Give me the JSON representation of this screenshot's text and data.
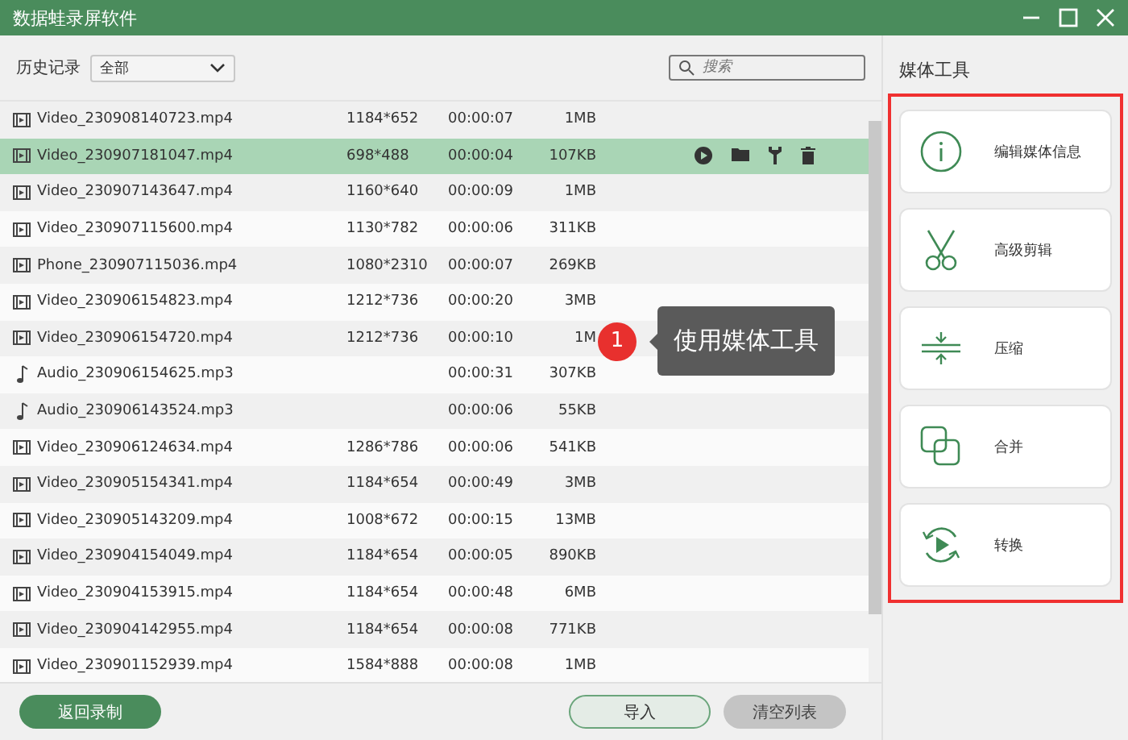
{
  "window": {
    "title": "数据蛙录屏软件"
  },
  "toolbar": {
    "history_label": "历史记录",
    "filter": "全部",
    "search": {
      "placeholder": "搜索"
    }
  },
  "files": [
    {
      "kind": "video",
      "name": "Video_230908140723.mp4",
      "resolution": "1184*652",
      "duration": "00:00:07",
      "size": "1MB",
      "selected": false
    },
    {
      "kind": "video",
      "name": "Video_230907181047.mp4",
      "resolution": "698*488",
      "duration": "00:00:04",
      "size": "107KB",
      "selected": true
    },
    {
      "kind": "video",
      "name": "Video_230907143647.mp4",
      "resolution": "1160*640",
      "duration": "00:00:09",
      "size": "1MB",
      "selected": false
    },
    {
      "kind": "video",
      "name": "Video_230907115600.mp4",
      "resolution": "1130*782",
      "duration": "00:00:06",
      "size": "311KB",
      "selected": false
    },
    {
      "kind": "video",
      "name": "Phone_230907115036.mp4",
      "resolution": "1080*2310",
      "duration": "00:00:07",
      "size": "269KB",
      "selected": false
    },
    {
      "kind": "video",
      "name": "Video_230906154823.mp4",
      "resolution": "1212*736",
      "duration": "00:00:20",
      "size": "3MB",
      "selected": false
    },
    {
      "kind": "video",
      "name": "Video_230906154720.mp4",
      "resolution": "1212*736",
      "duration": "00:00:10",
      "size": "1M",
      "selected": false
    },
    {
      "kind": "audio",
      "name": "Audio_230906154625.mp3",
      "duration": "00:00:31",
      "size": "307KB",
      "selected": false
    },
    {
      "kind": "audio",
      "name": "Audio_230906143524.mp3",
      "duration": "00:00:06",
      "size": "55KB",
      "selected": false
    },
    {
      "kind": "video",
      "name": "Video_230906124634.mp4",
      "resolution": "1286*786",
      "duration": "00:00:06",
      "size": "541KB",
      "selected": false
    },
    {
      "kind": "video",
      "name": "Video_230905154341.mp4",
      "resolution": "1184*654",
      "duration": "00:00:49",
      "size": "3MB",
      "selected": false
    },
    {
      "kind": "video",
      "name": "Video_230905143209.mp4",
      "resolution": "1008*672",
      "duration": "00:00:15",
      "size": "13MB",
      "selected": false
    },
    {
      "kind": "video",
      "name": "Video_230904154049.mp4",
      "resolution": "1184*654",
      "duration": "00:00:05",
      "size": "890KB",
      "selected": false
    },
    {
      "kind": "video",
      "name": "Video_230904153915.mp4",
      "resolution": "1184*654",
      "duration": "00:00:48",
      "size": "6MB",
      "selected": false
    },
    {
      "kind": "video",
      "name": "Video_230904142955.mp4",
      "resolution": "1184*654",
      "duration": "00:00:08",
      "size": "771KB",
      "selected": false
    },
    {
      "kind": "video",
      "name": "Video_230901152939.mp4",
      "resolution": "1584*888",
      "duration": "00:00:08",
      "size": "1MB",
      "selected": false
    }
  ],
  "callout": {
    "number": "1",
    "text": "使用媒体工具"
  },
  "media_tools": {
    "title": "媒体工具",
    "items": [
      {
        "kind": "info",
        "label": "编辑媒体信息"
      },
      {
        "kind": "scissors",
        "label": "高级剪辑"
      },
      {
        "kind": "compress",
        "label": "压缩"
      },
      {
        "kind": "merge",
        "label": "合并"
      },
      {
        "kind": "convert",
        "label": "转换"
      }
    ]
  },
  "footer": {
    "back": "返回录制",
    "import": "导入",
    "clear": "清空列表"
  }
}
